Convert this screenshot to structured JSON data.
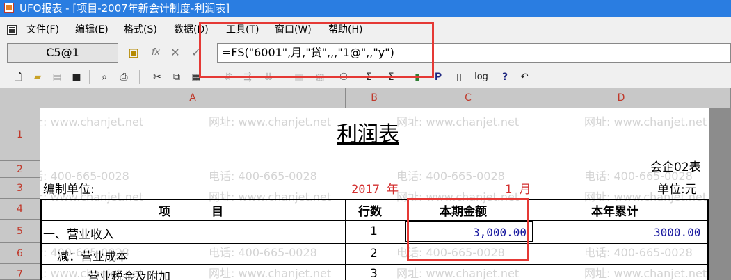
{
  "window": {
    "title": "UFO报表 - [项目-2007年新会计制度-利润表]"
  },
  "menu": [
    {
      "label": "文件(F)"
    },
    {
      "label": "编辑(E)"
    },
    {
      "label": "格式(S)"
    },
    {
      "label": "数据(D)"
    },
    {
      "label": "工具(T)"
    },
    {
      "label": "窗口(W)"
    },
    {
      "label": "帮助(H)"
    }
  ],
  "formula_bar": {
    "cell_ref": "C5@1",
    "formula": "=FS(\"6001\",月,\"贷\",,,\"1@\",,\"y\")"
  },
  "columns": [
    "A",
    "B",
    "C",
    "D"
  ],
  "rows": [
    "1",
    "2",
    "3",
    "4",
    "5",
    "6",
    "7"
  ],
  "report": {
    "title": "利润表",
    "code": "会企02表",
    "org_label": "编制单位:",
    "year": "2017 年",
    "month": "1 月",
    "unit": "单位:元",
    "headers": {
      "item": "项          目",
      "line": "行数",
      "current": "本期金额",
      "ytd": "本年累计"
    },
    "lines": [
      {
        "item": "一、营业收入",
        "line": "1",
        "current": "3,000.00",
        "ytd": "3000.00"
      },
      {
        "item": "减：营业成本",
        "line": "2",
        "current": "",
        "ytd": ""
      },
      {
        "item": "营业税金及附加",
        "line": "3",
        "current": "",
        "ytd": ""
      }
    ]
  },
  "watermark": {
    "phone": "电话: 400-665-0028",
    "site": "网址: www.chanjet.net"
  },
  "colors": {
    "titlebar": "#2a7de1",
    "header_label": "#c0392b",
    "value_blue": "#1a1aa0",
    "highlight": "#e53935"
  }
}
